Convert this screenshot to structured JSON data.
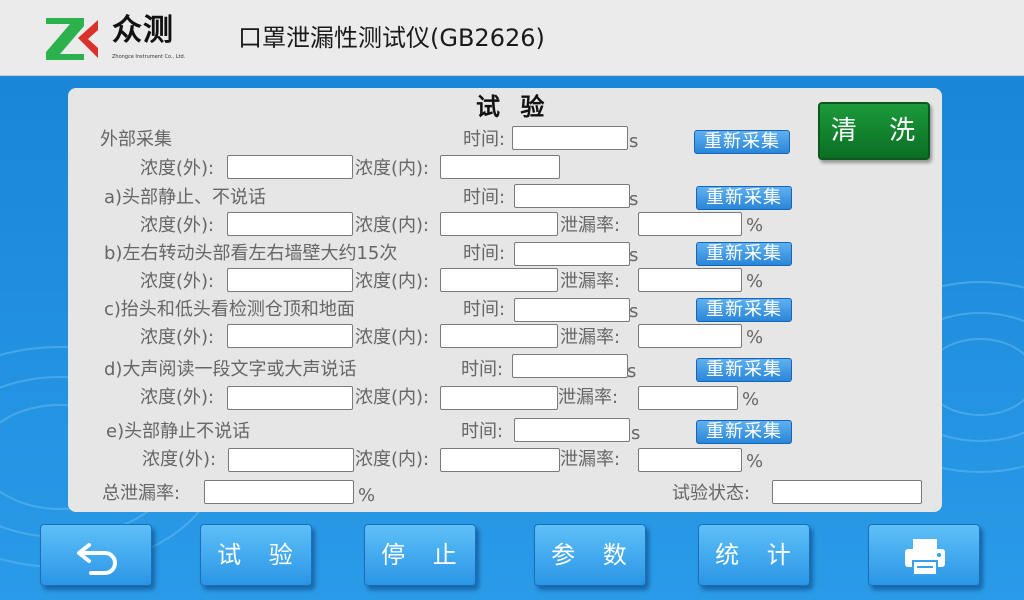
{
  "header": {
    "logo_cn": "众测",
    "logo_en": "Zhongce Instrument Co., Ltd.",
    "title": "口罩泄漏性测试仪(GB2626)"
  },
  "panel": {
    "title": "试 验",
    "labels": {
      "time": "时间:",
      "sec": "s",
      "conc_out": "浓度(外):",
      "conc_in": "浓度(内):",
      "leak": "泄漏率:",
      "pct": "%",
      "resample": "重新采集"
    },
    "sections": [
      {
        "name": "外部采集",
        "time": "",
        "out": "",
        "in": ""
      },
      {
        "name": "a)头部静止、不说话",
        "time": "",
        "out": "",
        "in": "",
        "leak": ""
      },
      {
        "name": "b)左右转动头部看左右墙壁大约15次",
        "time": "",
        "out": "",
        "in": "",
        "leak": ""
      },
      {
        "name": "c)抬头和低头看检测仓顶和地面",
        "time": "",
        "out": "",
        "in": "",
        "leak": ""
      },
      {
        "name": "d)大声阅读一段文字或大声说话",
        "time": "",
        "out": "",
        "in": "",
        "leak": ""
      },
      {
        "name": "e)头部静止不说话",
        "time": "",
        "out": "",
        "in": "",
        "leak": ""
      }
    ],
    "total_leak_label": "总泄漏率:",
    "total_leak_value": "",
    "status_label": "试验状态:",
    "status_value": ""
  },
  "clean_button": "清 洗",
  "nav": {
    "back_icon": "back-arrow-icon",
    "test": "试 验",
    "stop": "停 止",
    "params": "参 数",
    "stats": "统 计",
    "print_icon": "printer-icon"
  },
  "colors": {
    "background": "#1d8fe0",
    "header": "#ebebeb",
    "panel": "#e6e6e6",
    "logo_green": "#2bb24c",
    "logo_red": "#d9322a",
    "clean_green": "#138a33",
    "button_blue": "#3aa2ec"
  }
}
